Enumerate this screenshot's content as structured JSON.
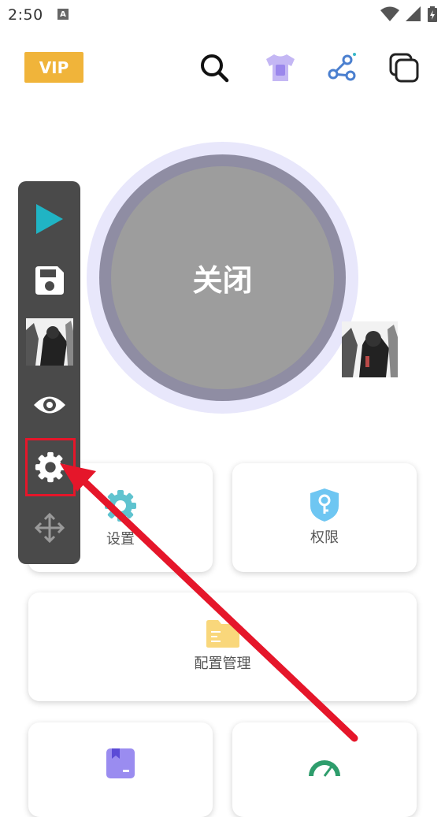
{
  "status_bar": {
    "time": "2:50",
    "notification_glyph": "A"
  },
  "header": {
    "vip_label": "VIP"
  },
  "main_button": {
    "label": "关闭"
  },
  "cards": {
    "settings": {
      "label": "设置"
    },
    "permissions": {
      "label": "权限"
    },
    "config": {
      "label": "配置管理"
    }
  },
  "colors": {
    "vip": "#f0b43a",
    "accent_teal": "#39b8c8",
    "arrow_red": "#e5162a",
    "toolbar_bg": "#4a4a4a"
  }
}
